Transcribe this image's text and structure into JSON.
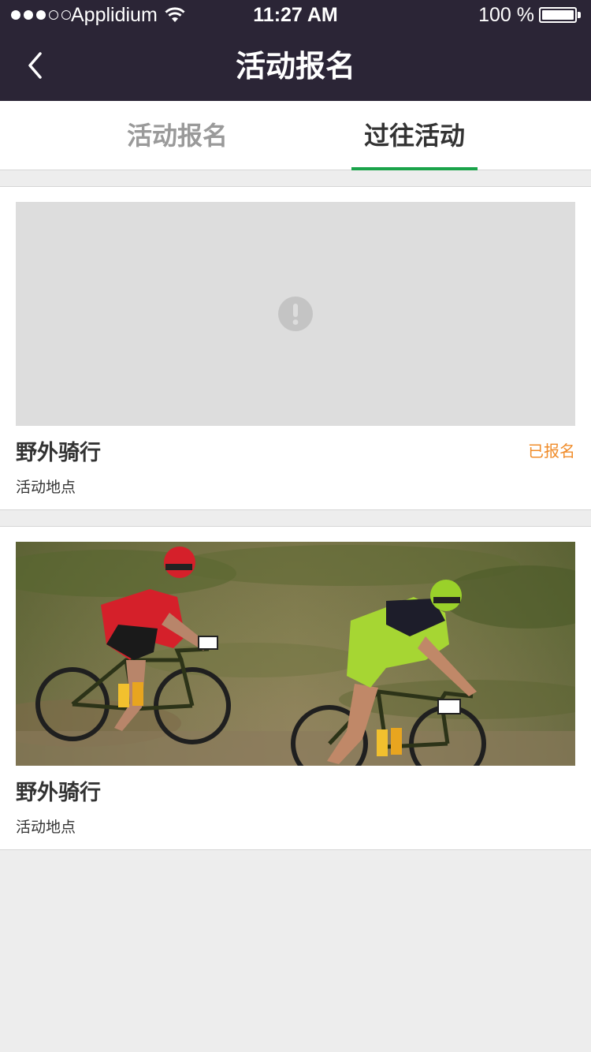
{
  "status_bar": {
    "carrier": "Applidium",
    "time": "11:27 AM",
    "battery_percent": "100 %",
    "signal_bars_filled": 3,
    "signal_bars_total": 5,
    "battery_level": 1.0
  },
  "nav": {
    "title": "活动报名",
    "back_icon": "chevron-left-icon"
  },
  "tabs": [
    {
      "label": "活动报名",
      "active": false
    },
    {
      "label": "过往活动",
      "active": true
    }
  ],
  "colors": {
    "header_bg": "#2b2536",
    "accent_green": "#1aa34a",
    "status_orange": "#f08c2a",
    "page_bg": "#ededed",
    "placeholder_bg": "#dddddd"
  },
  "events": [
    {
      "title": "野外骑行",
      "location": "活动地点",
      "status": "已报名",
      "image": "image-error-placeholder"
    },
    {
      "title": "野外骑行",
      "location": "活动地点",
      "status": "",
      "image": "mountain-bike-racers-photo"
    }
  ]
}
